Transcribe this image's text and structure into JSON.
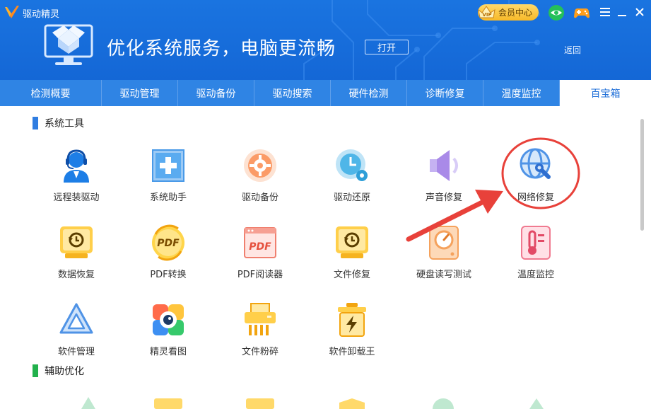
{
  "app": {
    "title": "驱动精灵"
  },
  "banner": {
    "headline": "优化系统服务，电脑更流畅",
    "open_label": "打开",
    "back_label": "返回"
  },
  "topbar": {
    "vip_label": "会员中心",
    "vip_crown_text": "VIP"
  },
  "tabs": [
    {
      "label": "检测概要"
    },
    {
      "label": "驱动管理"
    },
    {
      "label": "驱动备份"
    },
    {
      "label": "驱动搜索"
    },
    {
      "label": "硬件检测"
    },
    {
      "label": "诊断修复"
    },
    {
      "label": "温度监控"
    },
    {
      "label": "百宝箱",
      "active": true
    }
  ],
  "sections": {
    "system_tools": {
      "title": "系统工具",
      "accent": "#2f7de1"
    },
    "assist_optimize": {
      "title": "辅助优化",
      "accent": "#22b14c"
    }
  },
  "tools": [
    {
      "label": "远程装驱动",
      "icon": "support-agent-icon"
    },
    {
      "label": "系统助手",
      "icon": "windows-tile-icon"
    },
    {
      "label": "驱动备份",
      "icon": "backup-gear-icon"
    },
    {
      "label": "驱动还原",
      "icon": "clock-restore-icon"
    },
    {
      "label": "声音修复",
      "icon": "speaker-icon"
    },
    {
      "label": "网络修复",
      "icon": "globe-wrench-icon"
    },
    {
      "label": "数据恢复",
      "icon": "data-recovery-icon"
    },
    {
      "label": "PDF转换",
      "icon": "pdf-convert-icon",
      "icon_text": "PDF"
    },
    {
      "label": "PDF阅读器",
      "icon": "pdf-reader-icon",
      "icon_text": "PDF"
    },
    {
      "label": "文件修复",
      "icon": "file-repair-icon"
    },
    {
      "label": "硬盘读写测试",
      "icon": "disk-gauge-icon"
    },
    {
      "label": "温度监控",
      "icon": "thermometer-icon"
    },
    {
      "label": "软件管理",
      "icon": "software-triangle-icon"
    },
    {
      "label": "精灵看图",
      "icon": "image-viewer-icon"
    },
    {
      "label": "文件粉碎",
      "icon": "shredder-icon"
    },
    {
      "label": "软件卸载王",
      "icon": "uninstall-trash-icon"
    }
  ],
  "annotation": {
    "color": "#e8413a"
  }
}
